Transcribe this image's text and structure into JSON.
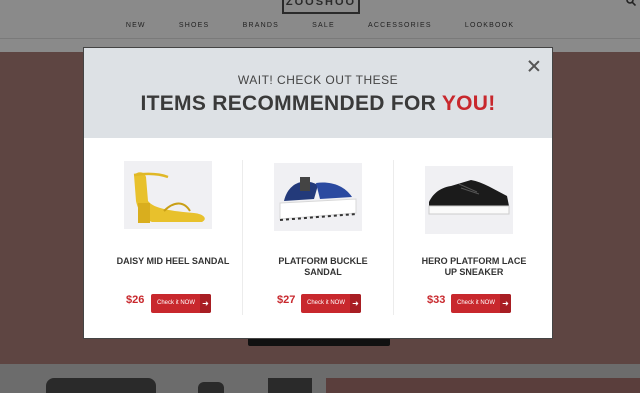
{
  "site": {
    "logo": "ZOOSHOO",
    "top_left": "",
    "search_icon": "search-icon",
    "nav": [
      "NEW",
      "SHOES",
      "BRANDS",
      "SALE",
      "ACCESSORIES",
      "LOOKBOOK"
    ]
  },
  "modal": {
    "kicker": "WAIT! CHECK OUT THESE",
    "headline_main": "ITEMS RECOMMENDED FOR ",
    "headline_accent": "YOU!",
    "accent_color": "#c8282d",
    "close_icon": "close-icon",
    "products": [
      {
        "name": "DAISY MID HEEL SANDAL",
        "price": "$26",
        "cta": "Check it NOW",
        "image": "yellow-sandal"
      },
      {
        "name": "PLATFORM BUCKLE SANDAL",
        "price": "$27",
        "cta": "Check it NOW",
        "image": "platform-sandal"
      },
      {
        "name": "HERO PLATFORM LACE UP SNEAKER",
        "price": "$33",
        "cta": "Check it NOW",
        "image": "black-sneaker"
      }
    ]
  }
}
